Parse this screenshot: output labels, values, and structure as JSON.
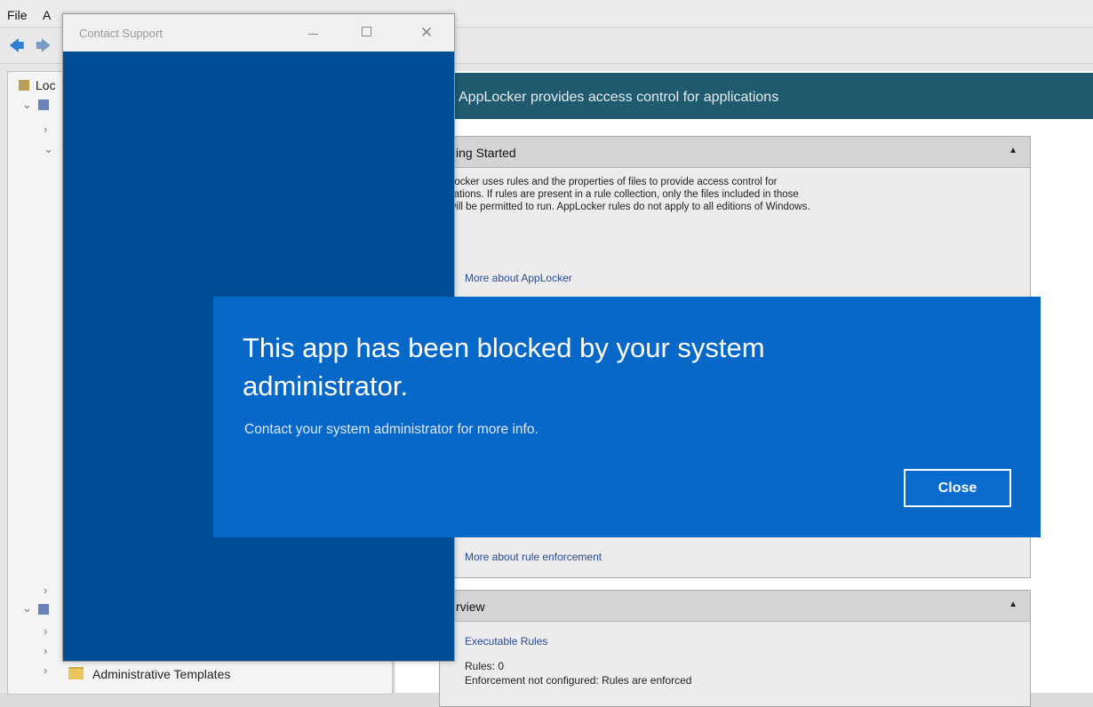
{
  "menu": {
    "file": "File"
  },
  "tree": {
    "root_label": "Loc",
    "bottom_item": "Administrative Templates"
  },
  "banner": {
    "text": "AppLocker provides access control for applications"
  },
  "getting_started": {
    "title": "ing Started",
    "body_lines": [
      "Locker uses rules and the properties of files to provide access control for",
      "cations. If rules are present in a rule collection, only the files included in those",
      "will be permitted to run. AppLocker rules do not apply to all editions of Windows."
    ],
    "link_more": "More about AppLocker",
    "link_enforcement": "More about rule enforcement"
  },
  "overview": {
    "title": "rview",
    "link_executable": "Executable Rules",
    "rules_count": "Rules: 0",
    "enforcement": "Enforcement not configured: Rules are enforced"
  },
  "support_window": {
    "title": "Contact Support",
    "close_glyph": "✕"
  },
  "dialog": {
    "heading": "This app has been blocked by your system administrator.",
    "subtext": "Contact your system administrator for more info.",
    "close_label": "Close"
  },
  "colors": {
    "dialog_bg": "#0868c8",
    "support_bg": "#004f96",
    "banner_bg": "#1f5a6e"
  }
}
